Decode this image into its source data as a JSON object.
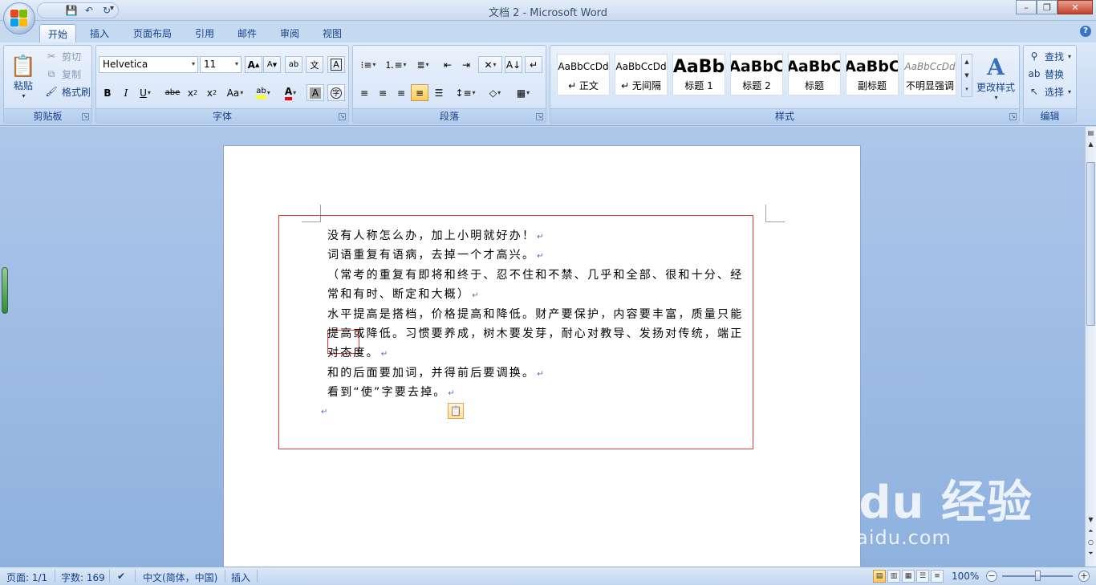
{
  "window": {
    "title": "文档 2 - Microsoft Word"
  },
  "tabs": [
    "开始",
    "插入",
    "页面布局",
    "引用",
    "邮件",
    "审阅",
    "视图"
  ],
  "clipboard": {
    "paste": "粘贴",
    "cut": "剪切",
    "copy": "复制",
    "format_painter": "格式刷",
    "label": "剪贴板"
  },
  "font": {
    "name": "Helvetica",
    "size": "11",
    "label": "字体",
    "aa": "Aa"
  },
  "paragraph": {
    "label": "段落"
  },
  "styles": {
    "label": "样式",
    "items": [
      {
        "sample": "AaBbCcDd",
        "name": "↵ 正文"
      },
      {
        "sample": "AaBbCcDd",
        "name": "↵ 无间隔"
      },
      {
        "sample": "AaBb",
        "name": "标题 1"
      },
      {
        "sample": "AaBbC",
        "name": "标题 2"
      },
      {
        "sample": "AaBbC",
        "name": "标题"
      },
      {
        "sample": "AaBbC",
        "name": "副标题"
      },
      {
        "sample": "AaBbCcDd",
        "name": "不明显强调"
      }
    ],
    "change_styles": "更改样式"
  },
  "editing": {
    "find": "查找",
    "replace": "替换",
    "select": "选择",
    "label": "编辑"
  },
  "document": {
    "lines": [
      "没有人称怎么办，加上小明就好办！",
      "词语重复有语病，去掉一个才高兴。",
      "（常考的重复有即将和终于、忍不住和不禁、几乎和全部、很和十分、经",
      "常和有时、断定和大概）",
      "水平提高是搭档，价格提高和降低。财产要保护，内容要丰富，质量只能",
      "提高或降低。习惯要养成，树木要发芽，耐心对教导、发扬对传统，端正",
      "对态度。",
      "和的后面要加词，并得前后要调换。",
      "看到“使”字要去掉。"
    ],
    "mark": "↵"
  },
  "status": {
    "page": "页面: 1/1",
    "words": "字数: 169",
    "language": "中文(简体，中国)",
    "mode": "插入",
    "zoom": "100%"
  },
  "watermark": {
    "logo": "Bai  du 经验",
    "url": "jingyan.baidu.com"
  },
  "colors": {
    "accent": "#15428b",
    "ribbon": "#dbe8f8",
    "selection_box": "#e03c3c",
    "font_color": "#ff0000",
    "highlight": "#ffff00"
  }
}
